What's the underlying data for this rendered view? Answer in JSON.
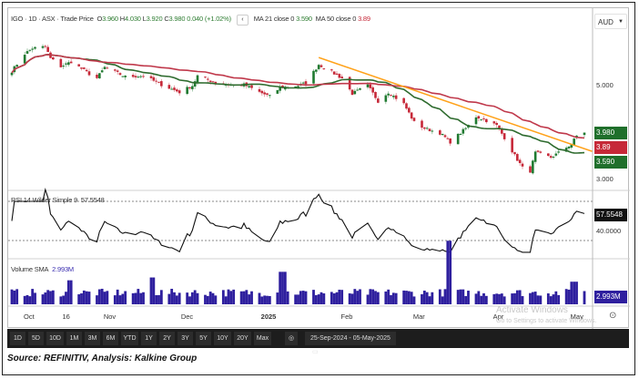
{
  "legend": {
    "symbol": "IGO · 1D · ASX · Trade Price",
    "open_label": "O",
    "open": "3.960",
    "high_label": "H",
    "high": "4.030",
    "low_label": "L",
    "low": "3.920",
    "close_label": "C",
    "close": "3.980",
    "change": "0.040 (+1.02%)",
    "collapse_glyph": "‹",
    "ma21_label": "MA 21 close 0",
    "ma21_value": "3.590",
    "ma50_label": "MA 50 close 0",
    "ma50_value": "3.89"
  },
  "currency_select": {
    "value": "AUD",
    "icon": "chevron-down-icon"
  },
  "price_axis": {
    "labels": [
      "5.000",
      "3.000"
    ],
    "ticks": [
      5,
      3
    ]
  },
  "price_tags": {
    "last": "3.980",
    "ma50": "3.89",
    "ma21": "3.590"
  },
  "rsi": {
    "label": "RSI 14 Wilder Simple 9",
    "value": "57.5548",
    "axis_label": "40.0000",
    "levels": [
      70,
      30
    ]
  },
  "volume": {
    "label": "Volume SMA",
    "value": "2.993M"
  },
  "x_axis": {
    "labels": [
      {
        "text": "Oct",
        "date": "2024-10-01",
        "bold": false
      },
      {
        "text": "16",
        "date": "2024-10-16",
        "bold": false
      },
      {
        "text": "Nov",
        "date": "2024-11-01",
        "bold": false
      },
      {
        "text": "Dec",
        "date": "2024-12-01",
        "bold": false
      },
      {
        "text": "2025",
        "date": "2025-01-01",
        "bold": true
      },
      {
        "text": "Feb",
        "date": "2025-02-01",
        "bold": false
      },
      {
        "text": "Mar",
        "date": "2025-03-01",
        "bold": false
      },
      {
        "text": "Apr",
        "date": "2025-04-01",
        "bold": false
      },
      {
        "text": "May",
        "date": "2025-05-01",
        "bold": false
      }
    ]
  },
  "settings_icon": "gear-icon",
  "toolbar": {
    "ranges": [
      "1D",
      "5D",
      "10D",
      "1M",
      "3M",
      "6M",
      "YTD",
      "1Y",
      "2Y",
      "3Y",
      "5Y",
      "10Y",
      "20Y",
      "Max"
    ],
    "reset_icon": "clock-icon",
    "date_range": "25-Sep-2024 - 05-May-2025",
    "calendar_icon": "calendar-icon"
  },
  "watermark": {
    "title": "Activate Windows",
    "subtitle": "Go to Settings to activate Windows."
  },
  "caption": "Source: REFINITIV, Analysis: Kalkine Group",
  "colors": {
    "up": "#1f7a30",
    "down": "#c62838",
    "ma21": "#2e6b2e",
    "ma50": "#c0394b",
    "trendline": "#ffa21a",
    "volume": "#2e1f9e",
    "rsi": "#111111"
  },
  "chart_data": {
    "type": "candlestick",
    "start": "2024-09-25",
    "end": "2025-05-05",
    "ylim": [
      2.85,
      6.0
    ],
    "approx_closes": [
      [
        "2024-09-25",
        5.29
      ],
      [
        "2024-09-30",
        5.66
      ],
      [
        "2024-10-03",
        5.78
      ],
      [
        "2024-10-08",
        5.81
      ],
      [
        "2024-10-10",
        5.56
      ],
      [
        "2024-10-14",
        5.39
      ],
      [
        "2024-10-18",
        5.49
      ],
      [
        "2024-10-25",
        5.23
      ],
      [
        "2024-10-28",
        5.14
      ],
      [
        "2024-10-31",
        5.37
      ],
      [
        "2024-11-08",
        5.17
      ],
      [
        "2024-11-15",
        5.19
      ],
      [
        "2024-11-22",
        5.0
      ],
      [
        "2024-11-29",
        4.84
      ],
      [
        "2024-12-04",
        4.98
      ],
      [
        "2024-12-06",
        5.19
      ],
      [
        "2024-12-13",
        5.04
      ],
      [
        "2024-12-18",
        5.0
      ],
      [
        "2024-12-24",
        5.0
      ],
      [
        "2024-12-30",
        4.84
      ],
      [
        "2025-01-03",
        4.75
      ],
      [
        "2025-01-07",
        4.94
      ],
      [
        "2025-01-14",
        4.98
      ],
      [
        "2025-01-17",
        5.04
      ],
      [
        "2025-01-22",
        5.43
      ],
      [
        "2025-01-27",
        5.27
      ],
      [
        "2025-01-31",
        5.14
      ],
      [
        "2025-02-04",
        4.81
      ],
      [
        "2025-02-10",
        4.98
      ],
      [
        "2025-02-14",
        4.65
      ],
      [
        "2025-02-18",
        4.84
      ],
      [
        "2025-02-24",
        4.59
      ],
      [
        "2025-02-28",
        4.2
      ],
      [
        "2025-03-04",
        4.07
      ],
      [
        "2025-03-10",
        3.97
      ],
      [
        "2025-03-14",
        3.78
      ],
      [
        "2025-03-20",
        4.07
      ],
      [
        "2025-03-24",
        4.32
      ],
      [
        "2025-03-27",
        4.26
      ],
      [
        "2025-04-01",
        4.13
      ],
      [
        "2025-04-04",
        3.87
      ],
      [
        "2025-04-08",
        3.49
      ],
      [
        "2025-04-11",
        3.23
      ],
      [
        "2025-04-14",
        3.16
      ],
      [
        "2025-04-16",
        3.55
      ],
      [
        "2025-04-22",
        3.45
      ],
      [
        "2025-04-25",
        3.55
      ],
      [
        "2025-04-30",
        3.74
      ],
      [
        "2025-05-02",
        3.91
      ],
      [
        "2025-05-05",
        3.98
      ]
    ],
    "moving_averages": [
      {
        "name": "MA 21 close 0",
        "period": 21
      },
      {
        "name": "MA 50 close 0",
        "period": 50
      }
    ],
    "trendline": [
      [
        "2025-01-22",
        5.58
      ],
      [
        "2025-05-08",
        3.58
      ]
    ],
    "volume_spikes": [
      [
        "2024-11-18",
        1.9
      ],
      [
        "2025-01-08",
        2.3
      ],
      [
        "2025-03-14",
        4.5
      ],
      [
        "2024-10-18",
        1.7
      ],
      [
        "2025-05-01",
        1.6
      ]
    ]
  }
}
